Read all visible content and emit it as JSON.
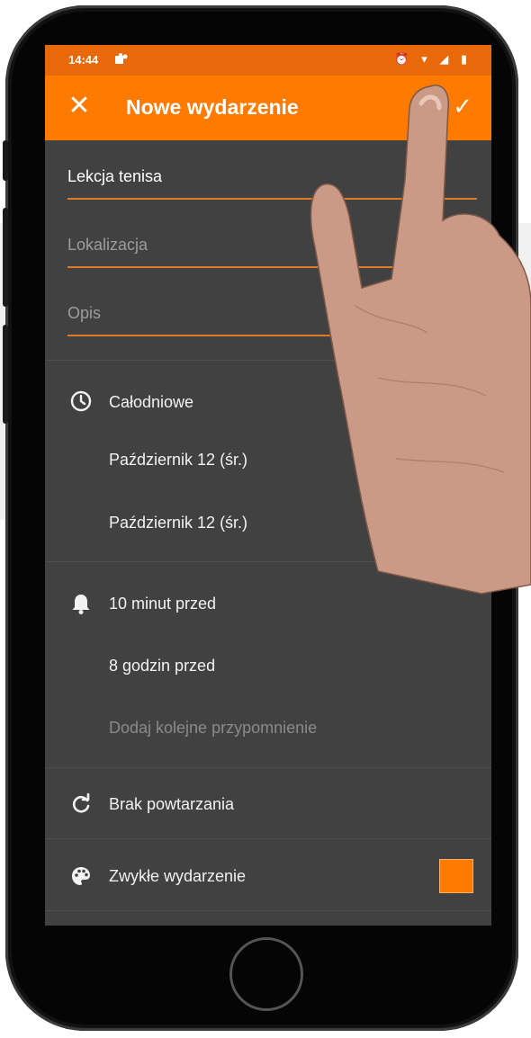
{
  "status_bar": {
    "time": "14:44",
    "app_icon": "teams-icon",
    "right_icons": "⏰ ▾ ◢ ▮"
  },
  "app_bar": {
    "close_label": "✕",
    "title": "Nowe wydarzenie",
    "confirm_label": "✓"
  },
  "form": {
    "title_value": "Lekcja tenisa",
    "location_placeholder": "Lokalizacja",
    "description_placeholder": "Opis"
  },
  "time_section": {
    "all_day_label": "Całodniowe",
    "start_date": "Październik 12 (śr.)",
    "end_date": "Październik 12 (śr.)"
  },
  "reminders": {
    "items": [
      "10 minut przed",
      "8 godzin przed"
    ],
    "add_label": "Dodaj kolejne przypomnienie"
  },
  "repeat": {
    "label": "Brak powtarzania"
  },
  "event_type": {
    "label": "Zwykłe wydarzenie",
    "color": "#ff7a00"
  },
  "colors": {
    "accent": "#ff7a00",
    "status_bar": "#e8690a",
    "background": "#414141"
  }
}
